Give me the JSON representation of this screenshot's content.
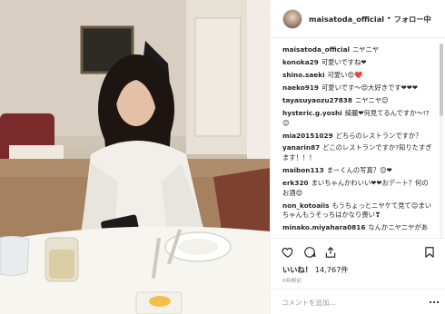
{
  "post": {
    "username": "maisatoda_official",
    "separator": "•",
    "follow_label": "フォロー中",
    "likes_label": "いいね！",
    "likes_count": "14,767件",
    "time_ago": "6時間前",
    "comment_placeholder": "コメントを追加..."
  },
  "comments": [
    {
      "user": "maisatoda_official",
      "text": "ニヤニヤ"
    },
    {
      "user": "konoka29",
      "text": "可愛いですね❤"
    },
    {
      "user": "shino.saeki",
      "text": "可愛い😍❤️"
    },
    {
      "user": "naeko919",
      "text": "可愛いです〜😍大好きです❤❤❤"
    },
    {
      "user": "tayasuyaozu27838",
      "text": "ニヤニヤ😊"
    },
    {
      "user": "hysteric.g.yoshi",
      "text": "綺麗❤何見てるんですか〜!?😊"
    },
    {
      "user": "mia20151029",
      "text": "どちらのレストランですか？"
    },
    {
      "user": "yanarin87",
      "text": "どこのレストランですか?知りたすぎます！！！"
    },
    {
      "user": "maibon113",
      "text": "まーくんの写真？😊❤"
    },
    {
      "user": "erk320",
      "text": "まいちゃんかわいい❤❤おデート？何のお酒😍"
    },
    {
      "user": "non_kotoaiis",
      "text": "もうちょっとニヤケて見て😊まいちゃんもうそっちはかなり喪い❣"
    },
    {
      "user": "minako.miyahara0816",
      "text": "なんかニヤニヤがあ"
    }
  ],
  "icons": {
    "like": "heart-icon",
    "comment": "speech-bubble-icon",
    "share": "share-icon",
    "save": "bookmark-icon",
    "more": "ellipsis-icon"
  }
}
